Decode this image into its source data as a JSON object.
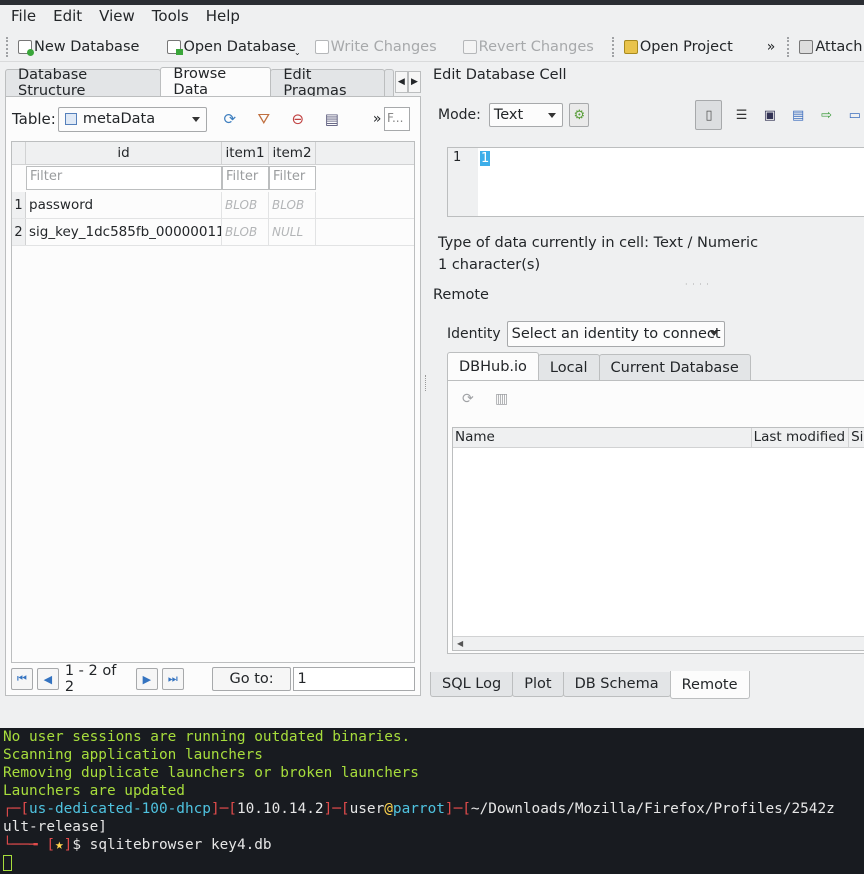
{
  "menu": [
    "File",
    "Edit",
    "View",
    "Tools",
    "Help"
  ],
  "toolbar": {
    "new_db": "New Database",
    "open_db": "Open Database",
    "write": "Write Changes",
    "revert": "Revert Changes",
    "open_project": "Open Project",
    "overflow": "»",
    "attach": "Attach D"
  },
  "left_tabs": [
    "Database Structure",
    "Browse Data",
    "Edit Pragmas"
  ],
  "browse": {
    "table_label": "Table:",
    "table_value": "metaData",
    "filter_placeholder": "F...",
    "columns": [
      "id",
      "item1",
      "item2"
    ],
    "filter_text": "Filter",
    "rows": [
      {
        "n": "1",
        "id": "password",
        "item1": "BLOB",
        "item2": "BLOB"
      },
      {
        "n": "2",
        "id": "sig_key_1dc585fb_00000011",
        "item1": "BLOB",
        "item2": "NULL"
      }
    ],
    "count": "1 - 2 of 2",
    "goto_label": "Go to:",
    "goto_value": "1"
  },
  "edit_cell": {
    "title": "Edit Database Cell",
    "mode_label": "Mode:",
    "mode_value": "Text",
    "line_no": "1",
    "content": "1",
    "type_info": "Type of data currently in cell: Text / Numeric",
    "size_info": "1 character(s)"
  },
  "remote": {
    "title": "Remote",
    "identity_label": "Identity",
    "identity_value": "Select an identity to connect",
    "tabs": [
      "DBHub.io",
      "Local",
      "Current Database"
    ],
    "columns": [
      "Name",
      "Last modified",
      "Si"
    ]
  },
  "bottom_tabs": [
    "SQL Log",
    "Plot",
    "DB Schema",
    "Remote"
  ],
  "terminal": {
    "lines": [
      "No user sessions are running outdated binaries.",
      "Scanning application launchers",
      "Removing duplicate launchers or broken launchers",
      "Launchers are updated"
    ],
    "host": "us-dedicated-100-dhcp",
    "ip": "10.10.14.2",
    "user": "user",
    "at": "@",
    "machine": "parrot",
    "path": "~/Downloads/Mozilla/Firefox/Profiles/2542z",
    "path_cont": "ult-release]",
    "command": "sqlitebrowser key4.db"
  }
}
